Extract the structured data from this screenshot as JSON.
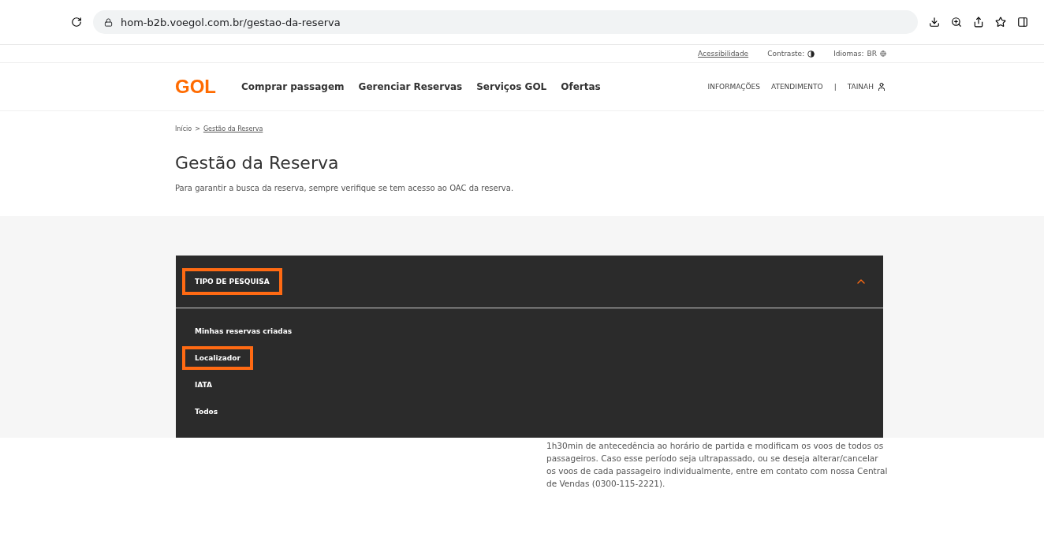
{
  "browser": {
    "url": "hom-b2b.voegol.com.br/gestao-da-reserva"
  },
  "utility_bar": {
    "accessibility": "Acessibilidade",
    "contrast": "Contraste:",
    "language_label": "Idiomas:",
    "language": "BR"
  },
  "nav": {
    "logo": "GOL",
    "links": [
      "Comprar passagem",
      "Gerenciar Reservas",
      "Serviços GOL",
      "Ofertas"
    ],
    "right_links": [
      "INFORMAÇÕES",
      "ATENDIMENTO"
    ],
    "separator": "|",
    "user": "TAINAH"
  },
  "breadcrumb": [
    {
      "label": "Início",
      "current": false
    },
    {
      "label": "Gestão da Reserva",
      "current": true
    }
  ],
  "breadcrumb_separator": ">",
  "title": "Gestão da Reserva",
  "subtitle": "Para garantir a busca da reserva, sempre verifique se tem acesso ao OAC da reserva.",
  "dropdown": {
    "label": "TIPO DE PESQUISA",
    "label_highlighted": true,
    "expanded": true,
    "options": [
      {
        "label": "Minhas reservas criadas",
        "highlighted": false
      },
      {
        "label": "Localizador",
        "highlighted": true
      },
      {
        "label": "IATA",
        "highlighted": false
      },
      {
        "label": "Todos",
        "highlighted": false
      }
    ]
  },
  "notice_lines": [
    "1h30min de antecedência ao horário de partida e modificam os voos de todos os",
    "passageiros. Caso esse período seja ultrapassado, ou se deseja alterar/cancelar",
    "os voos de cada passageiro individualmente, entre em contato com nossa Central",
    "de Vendas (0300-115-2221)."
  ]
}
